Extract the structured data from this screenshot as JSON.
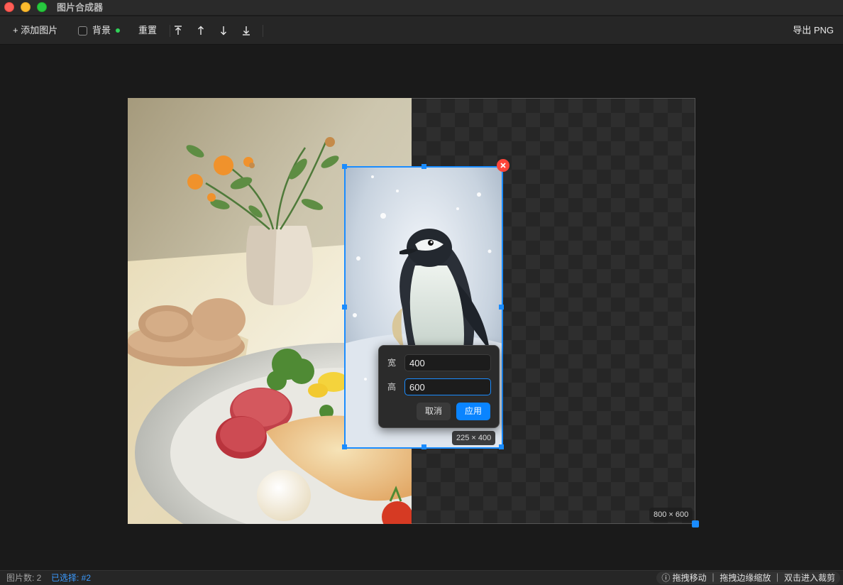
{
  "window": {
    "title": "图片合成器"
  },
  "toolbar": {
    "add_label": "+ 添加图片",
    "background_label": "背景",
    "reset_label": "重置",
    "layer_buttons": [
      "bring-to-front",
      "move-up",
      "move-down",
      "send-to-back"
    ],
    "export_label": "导出 PNG"
  },
  "canvas": {
    "size_label": "800 × 600",
    "selected_size_label": "225 × 400",
    "images": [
      {
        "name": "food-still-life-image"
      },
      {
        "name": "penguin-image",
        "selected": true
      }
    ]
  },
  "size_popup": {
    "width_label": "宽",
    "width_value": "400",
    "height_label": "高",
    "height_value": "600",
    "cancel_label": "取消",
    "apply_label": "应用"
  },
  "status": {
    "count_text": "图片数: 2",
    "selected_text": "已选择: #2",
    "hint_text": "ⓘ 拖拽移动 ｜ 拖拽边缘缩放 ｜ 双击进入裁剪"
  },
  "colors": {
    "accent": "#1a8cff",
    "apply_button": "#0a84ff",
    "delete": "#ff453a",
    "background_dot": "#30d158"
  }
}
